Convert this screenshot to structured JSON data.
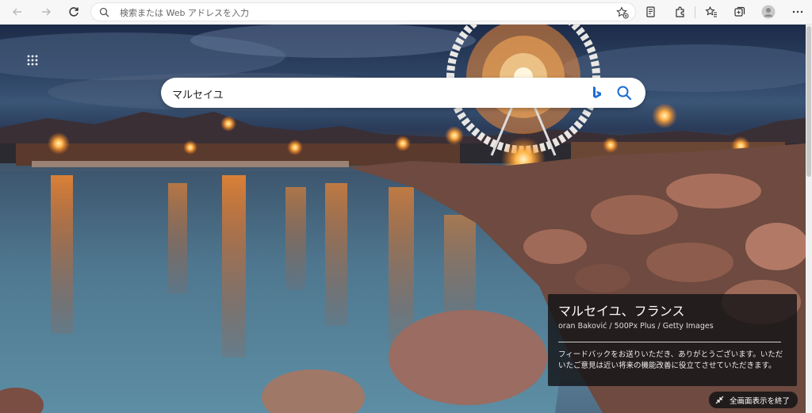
{
  "browser": {
    "address_placeholder": "検索または Web アドレスを入力"
  },
  "page": {
    "search_query": "マルセイユ",
    "image_info": {
      "title": "マルセイユ、フランス",
      "credit": "oran Baković / 500Px Plus / Getty Images",
      "feedback": "フィードバックをお送りいただき、ありがとうございます。いただいたご意見は近い将来の機能改善に役立てさせていただきます。"
    },
    "exit_fullscreen_label": "全画面表示を終了"
  },
  "colors": {
    "bing_blue": "#1b6ed6",
    "card_background": "#141416"
  }
}
